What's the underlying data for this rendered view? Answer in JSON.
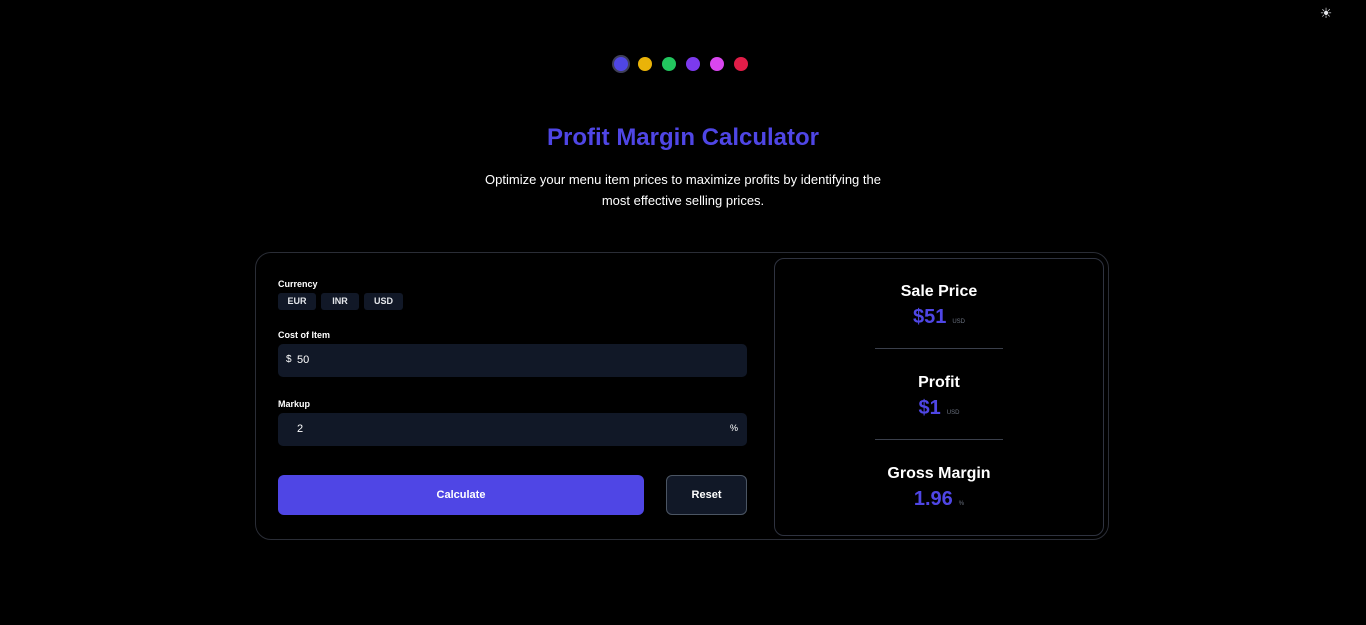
{
  "theme_toggle_icon": "sun-icon",
  "palette": {
    "selected_index": 0,
    "swatches": [
      "#4f46e5",
      "#eab308",
      "#22c55e",
      "#7c3aed",
      "#d946ef",
      "#e11d48"
    ]
  },
  "accent_color": "#4f46e5",
  "header": {
    "title": "Profit Margin Calculator",
    "subtitle": "Optimize your menu item prices to maximize profits by identifying the most effective selling prices."
  },
  "form": {
    "currency_label": "Currency",
    "currencies": [
      "EUR",
      "INR",
      "USD"
    ],
    "cost_label": "Cost of Item",
    "cost_prefix": "$",
    "cost_value": "50",
    "markup_label": "Markup",
    "markup_value": "2",
    "markup_suffix": "%",
    "calculate_label": "Calculate",
    "reset_label": "Reset"
  },
  "results": {
    "sale_price_title": "Sale Price",
    "sale_price_value": "$51",
    "sale_price_unit": "USD",
    "profit_title": "Profit",
    "profit_value": "$1",
    "profit_unit": "USD",
    "gross_margin_title": "Gross Margin",
    "gross_margin_value": "1.96",
    "gross_margin_unit": "%"
  }
}
